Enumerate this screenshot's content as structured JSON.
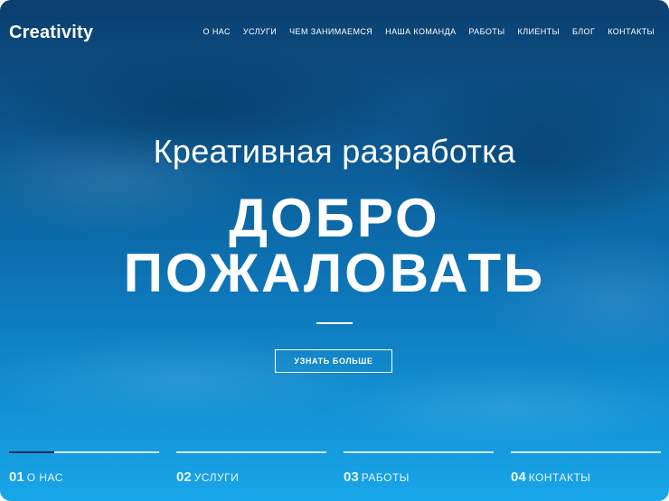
{
  "header": {
    "logo": "Creativity",
    "nav": [
      "О НАС",
      "УСЛУГИ",
      "ЧЕМ ЗАНИМАЕМСЯ",
      "НАША КОМАНДА",
      "РАБОТЫ",
      "КЛИЕНТЫ",
      "БЛОГ",
      "КОНТАКТЫ"
    ]
  },
  "hero": {
    "subtitle": "Креативная разработка",
    "title_line1": "ДОБРО",
    "title_line2": "ПОЖАЛОВАТЬ",
    "cta": "УЗНАТЬ БОЛЬШЕ"
  },
  "slides": [
    {
      "num": "01",
      "label": "О НАС"
    },
    {
      "num": "02",
      "label": "УСЛУГИ"
    },
    {
      "num": "03",
      "label": "РАБОТЫ"
    },
    {
      "num": "04",
      "label": "КОНТАКТЫ"
    }
  ],
  "active_slide_progress": 0.3,
  "colors": {
    "bg_top": "#0b3f6f",
    "bg_bottom": "#19a6ea",
    "text": "#ffffff"
  }
}
